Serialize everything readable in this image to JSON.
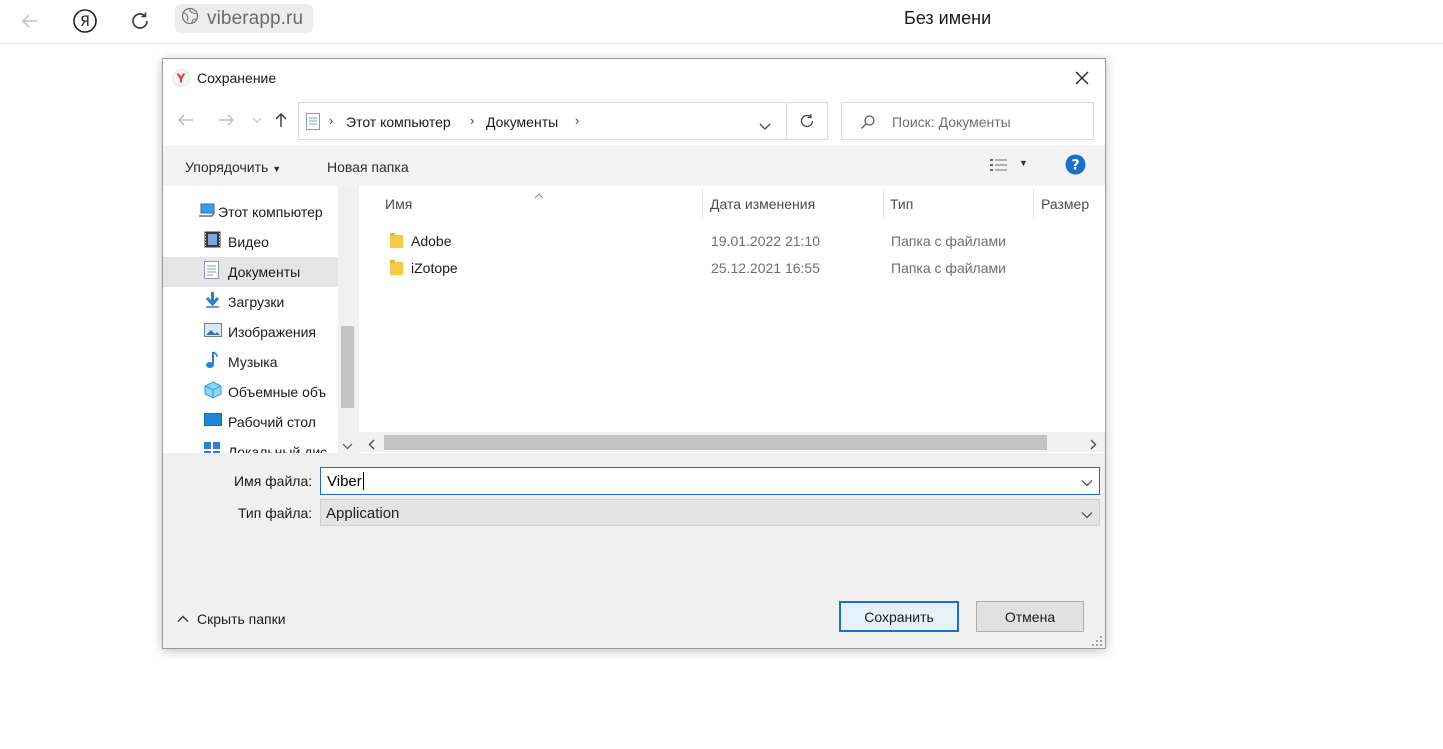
{
  "browser": {
    "back_icon": "arrow-left-icon",
    "yandex_icon": "yandex-logo-icon",
    "reload_icon": "reload-icon",
    "site_icon": "globe-icon",
    "url": "viberapp.ru",
    "tab_title": "Без имени"
  },
  "dialog": {
    "title": "Сохранение",
    "app_icon": "yandex-browser-icon",
    "close_icon": "close-icon",
    "address": {
      "crumbs": [
        "Этот компьютер",
        "Документы"
      ]
    },
    "search_placeholder": "Поиск: Документы",
    "toolbar": {
      "organize_label": "Упорядочить",
      "new_folder_label": "Новая папка",
      "help_icon": "help-icon",
      "view_icon": "view-details-icon"
    },
    "nav_pane": {
      "items": [
        {
          "label": "Этот компьютер",
          "icon": "computer-icon"
        },
        {
          "label": "Видео",
          "icon": "video-icon"
        },
        {
          "label": "Документы",
          "icon": "documents-icon",
          "selected": true
        },
        {
          "label": "Загрузки",
          "icon": "downloads-icon"
        },
        {
          "label": "Изображения",
          "icon": "pictures-icon"
        },
        {
          "label": "Музыка",
          "icon": "music-icon"
        },
        {
          "label": "Объемные объ",
          "icon": "3d-objects-icon"
        },
        {
          "label": "Рабочий стол",
          "icon": "desktop-icon"
        },
        {
          "label": "Локальный дис",
          "icon": "local-disk-icon"
        }
      ]
    },
    "file_list": {
      "columns": [
        "Имя",
        "Дата изменения",
        "Тип",
        "Размер"
      ],
      "rows": [
        {
          "name": "Adobe",
          "date": "19.01.2022 21:10",
          "type": "Папка с файлами"
        },
        {
          "name": "iZotope",
          "date": "25.12.2021 16:55",
          "type": "Папка с файлами"
        }
      ]
    },
    "bottom": {
      "filename_label": "Имя файла:",
      "filename_value": "Viber",
      "filetype_label": "Тип файла:",
      "filetype_value": "Application",
      "hide_folders_label": "Скрыть папки",
      "save_label": "Сохранить",
      "cancel_label": "Отмена"
    }
  },
  "colors": {
    "accent": "#1b6fc9",
    "selection": "#e5e5e5",
    "folder": "#f8c943"
  }
}
